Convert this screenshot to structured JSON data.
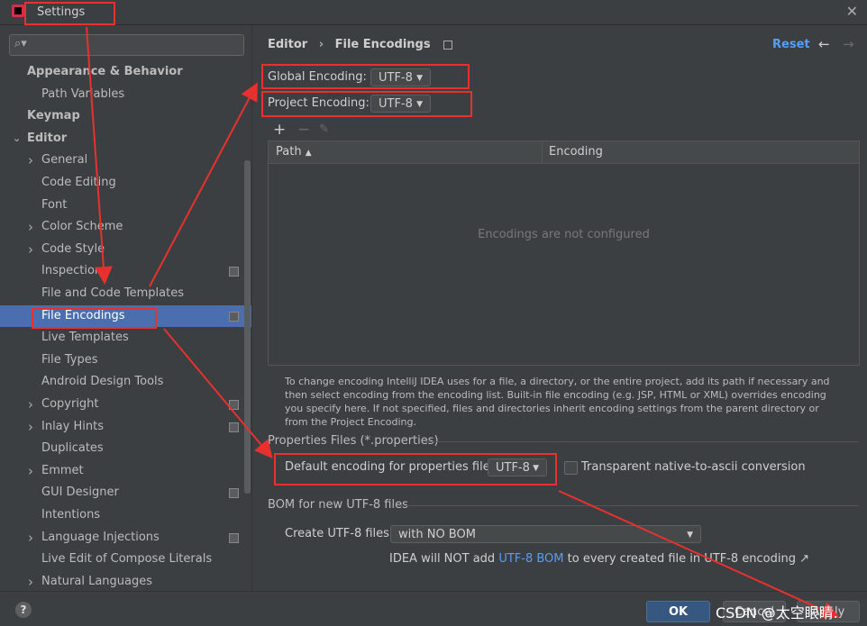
{
  "window": {
    "title": "Settings"
  },
  "search": {
    "placeholder": ""
  },
  "tree": [
    {
      "label": "Appearance & Behavior",
      "bold": true,
      "chev": ""
    },
    {
      "label": "Path Variables",
      "bold": false,
      "chev": ""
    },
    {
      "label": "Keymap",
      "bold": true,
      "chev": ""
    },
    {
      "label": "Editor",
      "bold": true,
      "chev": "down"
    },
    {
      "label": "General",
      "bold": false,
      "chev": "right"
    },
    {
      "label": "Code Editing",
      "bold": false,
      "chev": ""
    },
    {
      "label": "Font",
      "bold": false,
      "chev": ""
    },
    {
      "label": "Color Scheme",
      "bold": false,
      "chev": "right"
    },
    {
      "label": "Code Style",
      "bold": false,
      "chev": "right"
    },
    {
      "label": "Inspections",
      "bold": false,
      "chev": "",
      "page": true
    },
    {
      "label": "File and Code Templates",
      "bold": false,
      "chev": ""
    },
    {
      "label": "File Encodings",
      "bold": false,
      "chev": "",
      "page": true,
      "selected": true
    },
    {
      "label": "Live Templates",
      "bold": false,
      "chev": ""
    },
    {
      "label": "File Types",
      "bold": false,
      "chev": ""
    },
    {
      "label": "Android Design Tools",
      "bold": false,
      "chev": ""
    },
    {
      "label": "Copyright",
      "bold": false,
      "chev": "right",
      "page": true
    },
    {
      "label": "Inlay Hints",
      "bold": false,
      "chev": "right",
      "page": true
    },
    {
      "label": "Duplicates",
      "bold": false,
      "chev": ""
    },
    {
      "label": "Emmet",
      "bold": false,
      "chev": "right"
    },
    {
      "label": "GUI Designer",
      "bold": false,
      "chev": "",
      "page": true
    },
    {
      "label": "Intentions",
      "bold": false,
      "chev": ""
    },
    {
      "label": "Language Injections",
      "bold": false,
      "chev": "right",
      "page": true
    },
    {
      "label": "Live Edit of Compose Literals",
      "bold": false,
      "chev": ""
    },
    {
      "label": "Natural Languages",
      "bold": false,
      "chev": "right"
    }
  ],
  "breadcrumb": {
    "parent": "Editor",
    "separator": "›",
    "current": "File Encodings"
  },
  "header": {
    "reset": "Reset"
  },
  "global_encoding": {
    "label": "Global Encoding:",
    "value": "UTF-8"
  },
  "project_encoding": {
    "label": "Project Encoding:",
    "value": "UTF-8"
  },
  "table": {
    "columns": [
      "Path",
      "Encoding"
    ],
    "empty_text": "Encodings are not configured"
  },
  "description": "To change encoding IntelliJ IDEA uses for a file, a directory, or the entire project, add its path if necessary and then select encoding from the encoding list. Built-in file encoding (e.g. JSP, HTML or XML) overrides encoding you specify here. If not specified, files and directories inherit encoding settings from the parent directory or from the Project Encoding.",
  "properties": {
    "section": "Properties Files (*.properties)",
    "label": "Default encoding for properties files:",
    "value": "UTF-8",
    "checkbox_label": "Transparent native-to-ascii conversion",
    "checked": false
  },
  "bom": {
    "section": "BOM for new UTF-8 files",
    "label": "Create UTF-8 files:",
    "value": "with NO BOM",
    "note_prefix": "IDEA will NOT add ",
    "note_link": "UTF-8 BOM",
    "note_suffix": " to every created file in UTF-8 encoding ↗"
  },
  "buttons": {
    "ok": "OK",
    "cancel": "Cancel",
    "apply": "Apply",
    "help": "?"
  },
  "watermark": "CSDN @太空眼睛.",
  "colors": {
    "accent": "#589df6",
    "selection": "#4b6eaf",
    "annotation": "#e8302f"
  }
}
